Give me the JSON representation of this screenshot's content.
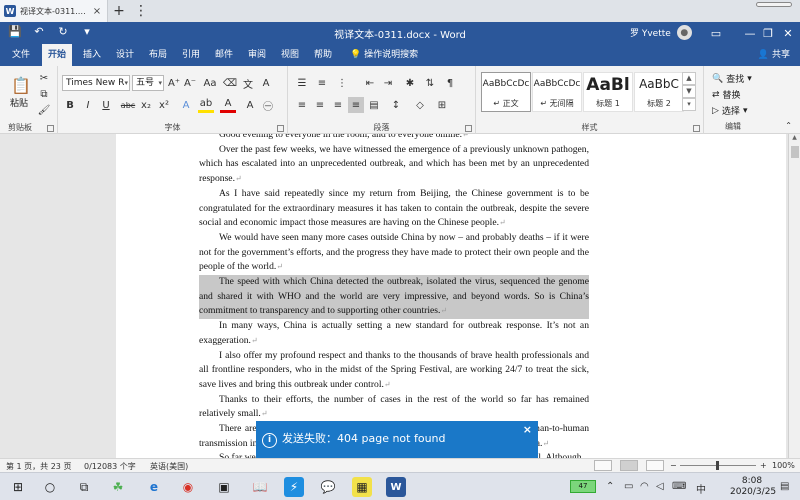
{
  "browser_tab": {
    "title": "视译文本-0311.docx - Wo...",
    "close": "×",
    "new_tab": "+",
    "menu": "⋮"
  },
  "titlebar": {
    "doc_title": "视译文本-0311.docx  -  Word",
    "user_name": "罗 Yvette",
    "buttons": {
      "save": "💾",
      "undo": "↶",
      "redo": "↻",
      "customize": "▾",
      "ribbon_display": "▭",
      "minimize": "—",
      "restore": "❐",
      "close": "✕"
    }
  },
  "menu": {
    "tabs": [
      "文件",
      "开始",
      "插入",
      "设计",
      "布局",
      "引用",
      "邮件",
      "审阅",
      "视图",
      "帮助"
    ],
    "active": "开始",
    "tell_me": "操作说明搜索",
    "share": "共享"
  },
  "ribbon": {
    "clipboard": {
      "paste": "粘贴",
      "label": "剪贴板"
    },
    "font": {
      "family": "Times New R",
      "size": "五号",
      "label": "字体"
    },
    "paragraph": {
      "label": "段落"
    },
    "styles": {
      "label": "样式",
      "items": [
        {
          "preview": "AaBbCcDc",
          "name": "↵ 正文"
        },
        {
          "preview": "AaBbCcDc",
          "name": "↵ 无间隔"
        },
        {
          "preview": "AaBl",
          "name": "标题 1"
        },
        {
          "preview": "AaBbC",
          "name": "标题 2"
        }
      ]
    },
    "editing": {
      "find": "查找",
      "replace": "替换",
      "select": "选择",
      "label": "编辑"
    }
  },
  "document": {
    "paragraphs": [
      {
        "text": "Good evening to everyone in the room, and to everyone online.",
        "highlight": false
      },
      {
        "text": "Over the past few weeks, we have witnessed the emergence of a previously unknown pathogen, which has escalated into an unprecedented outbreak, and which has been met by an unprecedented response.",
        "highlight": false
      },
      {
        "text": "As I have said repeatedly since my return from Beijing, the Chinese government is to be congratulated for the extraordinary measures it has taken to contain the outbreak, despite the severe social and economic impact those measures are having on the Chinese people.",
        "highlight": false
      },
      {
        "text": "We would have seen many more cases outside China by now – and probably deaths – if it were not for the government’s efforts, and the progress they have made to protect their own people and the people of the world.",
        "highlight": false
      },
      {
        "text": "The speed with which China detected the outbreak, isolated the virus, sequenced the genome and shared it with WHO and the world are very impressive, and beyond words. So is China’s commitment to transparency and to supporting other countries.",
        "highlight": true
      },
      {
        "text": "In many ways, China is actually setting a new standard for outbreak response. It’s not an exaggeration.",
        "highlight": false
      },
      {
        "text": "I also offer my profound respect and thanks to the thousands of brave health professionals and all frontline responders, who in the midst of the Spring Festival, are working 24/7 to treat the sick, save lives and bring this outbreak under control.",
        "highlight": false
      },
      {
        "text": "Thanks to their efforts, the number of cases in the rest of the world so far has remained relatively small.",
        "highlight": false
      },
      {
        "text": "There are now 68 cases in 15 countries outside China, including 8 cases of human-to-human transmission in 4 countries: Germany, Japan, Viet Nam and the United States of America.",
        "highlight": false
      },
      {
        "text": "So far we have not seen any deaths outside China, for which we must all be grateful. Although",
        "highlight": false
      }
    ],
    "para_mark": "↵"
  },
  "toast": {
    "message": "发送失败：404 page not found",
    "close": "×"
  },
  "statusbar": {
    "page": "第 1 页，共 23 页",
    "words": "0/12083 个字",
    "language": "英语(美国)",
    "zoom": "100%",
    "zoom_minus": "−",
    "zoom_plus": "+"
  },
  "taskbar": {
    "battery": "47",
    "ime": "中",
    "time": "8:08",
    "date": "2020/3/25"
  }
}
